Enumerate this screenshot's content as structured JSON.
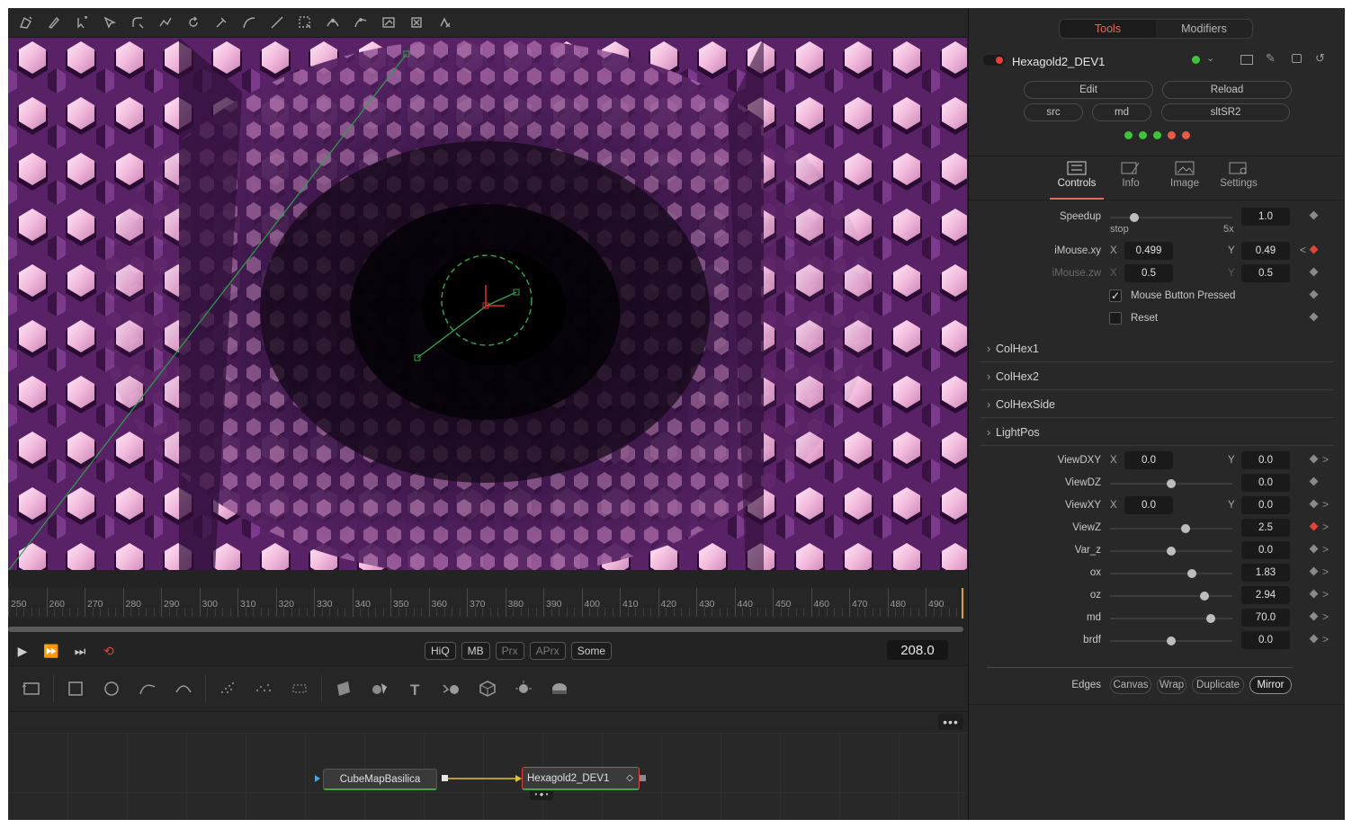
{
  "toolbar": {
    "icons": [
      "polygon-tool-icon",
      "paint-icon",
      "multipoint-icon",
      "select-icon",
      "modify-icon",
      "polyline-icon",
      "rotate-icon",
      "pick-icon",
      "curve-icon",
      "line-icon",
      "rect-select-icon",
      "bspline-icon",
      "spline-icon",
      "transform-icon",
      "delete-icon",
      "undo-icon"
    ]
  },
  "timeline": {
    "ticks": [
      "250",
      "260",
      "270",
      "280",
      "290",
      "300",
      "310",
      "320",
      "330",
      "340",
      "350",
      "360",
      "370",
      "380",
      "390",
      "400",
      "410",
      "420",
      "430",
      "440",
      "450",
      "460",
      "470",
      "480",
      "490"
    ],
    "current_frame": "208.0"
  },
  "transport": {
    "pills": [
      "HiQ",
      "MB",
      "Prx",
      "APrx",
      "Some"
    ]
  },
  "nodes": {
    "source": "CubeMapBasilica",
    "target": "Hexagold2_DEV1"
  },
  "inspector": {
    "tabs": [
      "Tools",
      "Modifiers"
    ],
    "tool_name": "Hexagold2_DEV1",
    "buttons": {
      "edit": "Edit",
      "reload": "Reload",
      "src": "src",
      "md": "md",
      "sltsr2": "sltSR2"
    },
    "status_colors": [
      "#3fc33a",
      "#3fc33a",
      "#3fc33a",
      "#e35a4a",
      "#e35a4a"
    ],
    "subtabs": [
      "Controls",
      "Info",
      "Image",
      "Settings"
    ],
    "speedup": {
      "label": "Speedup",
      "value": "1.0",
      "min_label": "stop",
      "max_label": "5x",
      "fraction": 0.2
    },
    "imouse_xy": {
      "label": "iMouse.xy",
      "x_axis": "X",
      "y_axis": "Y",
      "x": "0.499",
      "y": "0.49"
    },
    "imouse_zw": {
      "label": "iMouse.zw",
      "x_axis": "X",
      "y_axis": "Y",
      "x": "0.5",
      "y": "0.5"
    },
    "mouse_button_pressed": "Mouse Button Pressed",
    "reset": "Reset",
    "sections": [
      "ColHex1",
      "ColHex2",
      "ColHexSide",
      "LightPos"
    ],
    "viewdxy": {
      "label": "ViewDXY",
      "x_axis": "X",
      "y_axis": "Y",
      "x": "0.0",
      "y": "0.0"
    },
    "viewxy": {
      "label": "ViewXY",
      "x_axis": "X",
      "y_axis": "Y",
      "x": "0.0",
      "y": "0.0"
    },
    "sliders": [
      {
        "label": "ViewDZ",
        "value": "0.0",
        "fraction": 0.5
      },
      {
        "label": "ViewZ",
        "value": "2.5",
        "fraction": 0.62
      },
      {
        "label": "Var_z",
        "value": "0.0",
        "fraction": 0.5
      },
      {
        "label": "ox",
        "value": "1.83",
        "fraction": 0.67
      },
      {
        "label": "oz",
        "value": "2.94",
        "fraction": 0.77
      },
      {
        "label": "md",
        "value": "70.0",
        "fraction": 0.82
      },
      {
        "label": "brdf",
        "value": "0.0",
        "fraction": 0.5
      }
    ],
    "edges": {
      "label": "Edges",
      "options": [
        "Canvas",
        "Wrap",
        "Duplicate",
        "Mirror"
      ],
      "selected": "Mirror"
    }
  }
}
